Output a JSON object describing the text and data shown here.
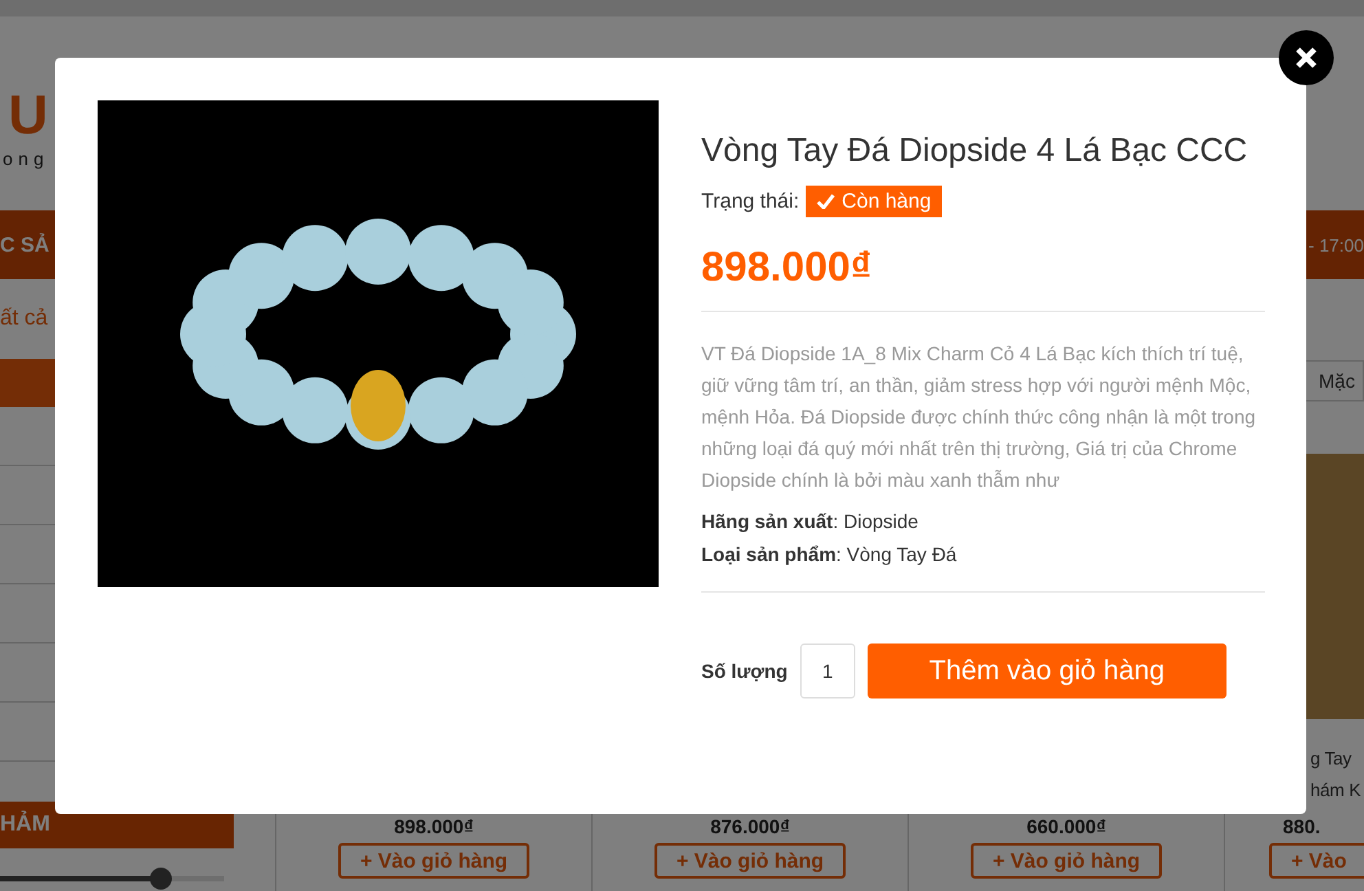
{
  "background_page": {
    "logo": "U",
    "tagline": "ong",
    "nav_left": "C SẢ",
    "nav_right": "- 17:00",
    "breadcrumb": "ất cả",
    "sort_option": "Mặc",
    "sidebar_heading": "HẢM",
    "price_slider": {
      "level": 0.72
    },
    "products": [
      {
        "price": "898.000₫",
        "button": "+ Vào giỏ hàng"
      },
      {
        "price": "876.000₫",
        "button": "+ Vào giỏ hàng"
      },
      {
        "price": "660.000₫",
        "button": "+ Vào giỏ hàng"
      },
      {
        "name_lines": [
          "g Tay",
          "hám K"
        ],
        "price": "880.",
        "button": "+ Vào"
      }
    ]
  },
  "modal": {
    "title": "Vòng Tay Đá Diopside 4 Lá Bạc CCC",
    "status_label": "Trạng thái:",
    "status_badge": "Còn hàng",
    "price": "898.000₫",
    "description": "VT Đá Diopside 1A_8 Mix Charm Cỏ 4 Lá Bạc kích thích trí tuệ, giữ vững tâm trí, an thần, giảm stress hợp với người mệnh Mộc, mệnh Hỏa. Đá Diopside được chính thức công nhận là một trong những loại đá quý mới nhất trên thị trường, Giá trị của Chrome Diopside chính là bởi màu xanh thẫm như",
    "specs": [
      "**Hãng sản xuất**: Diopside",
      "**Loại sản phẩm**: Vòng Tay Đá"
    ],
    "quantity_label": "Số lượng",
    "quantity": "1",
    "add_button": "Thêm vào giỏ hàng"
  }
}
